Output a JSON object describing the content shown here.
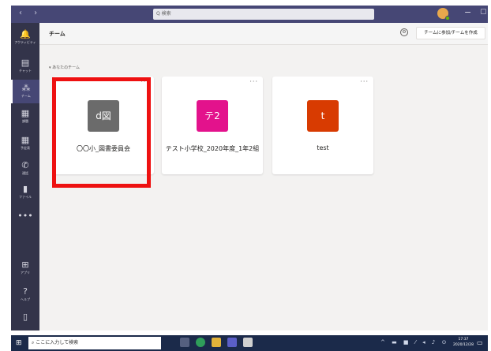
{
  "titlebar": {
    "nav_arrows": "‹ ›",
    "search_placeholder": "Q 検索",
    "minimize_glyph": "−",
    "maximize_glyph": "▢"
  },
  "appbar": {
    "items": [
      {
        "icon": "bell-icon",
        "glyph": "🔔",
        "label": "アクティビティ"
      },
      {
        "icon": "chat-icon",
        "glyph": "▤",
        "label": "チャット"
      },
      {
        "icon": "teams-icon",
        "glyph": "⁂",
        "label": "チーム"
      },
      {
        "icon": "assignments-icon",
        "glyph": "▦",
        "label": "課題"
      },
      {
        "icon": "calendar-icon",
        "glyph": "▦",
        "label": "予定表"
      },
      {
        "icon": "calls-icon",
        "glyph": "✆",
        "label": "通話"
      },
      {
        "icon": "files-icon",
        "glyph": "▮",
        "label": "ファイル"
      },
      {
        "icon": "more-icon",
        "glyph": "•••",
        "label": ""
      },
      {
        "icon": "apps-icon",
        "glyph": "⊞",
        "label": "アプリ"
      },
      {
        "icon": "help-icon",
        "glyph": "?",
        "label": "ヘルプ"
      },
      {
        "icon": "device-icon",
        "glyph": "▯",
        "label": ""
      }
    ],
    "active_index": 2
  },
  "main": {
    "title": "チーム",
    "join_button": "チームに参加/チームを作成",
    "section_label": "▾ あなたのチーム",
    "teams": [
      {
        "name": "〇〇小_図書委員会",
        "tile_text": "d図",
        "color": "#6b6b6b"
      },
      {
        "name": "テスト小学校_2020年度_1年2組",
        "tile_text": "テ2",
        "color": "#e3128c"
      },
      {
        "name": "test",
        "tile_text": "t",
        "color": "#d83b01"
      }
    ],
    "card_more": "···"
  },
  "taskbar": {
    "search_placeholder": "ここに入力して検索",
    "time": "17:37",
    "date": "2020/12/28"
  },
  "colors": {
    "titlebar": "#464775",
    "appbar": "#33344a",
    "highlight": "#ee1111"
  }
}
